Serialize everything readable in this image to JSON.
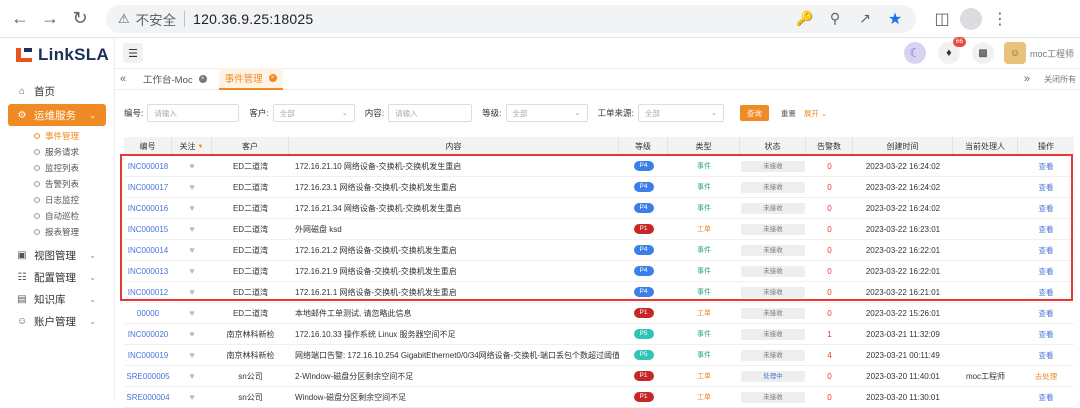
{
  "browser": {
    "security": "不安全",
    "url": "120.36.9.25:18025"
  },
  "app": {
    "logo": "LinkSLA",
    "user_name": "moc工程师",
    "notification_count": "66"
  },
  "sidebar": {
    "items": [
      {
        "label": "首页",
        "icon": "home-icon"
      },
      {
        "label": "运维服务",
        "icon": "service-icon",
        "active": true
      },
      {
        "label": "视图管理",
        "icon": "view-icon"
      },
      {
        "label": "配置管理",
        "icon": "config-icon"
      },
      {
        "label": "知识库",
        "icon": "kb-icon"
      },
      {
        "label": "账户管理",
        "icon": "account-icon"
      }
    ],
    "sub_items": [
      "事件管理",
      "服务请求",
      "监控列表",
      "告警列表",
      "日志监控",
      "自动巡检",
      "报表管理"
    ]
  },
  "tabs": {
    "items": [
      {
        "label": "工作台-Moc"
      },
      {
        "label": "事件管理"
      }
    ],
    "close_all": "关闭所有"
  },
  "filters": {
    "id_label": "编号:",
    "id_placeholder": "请输入",
    "customer_label": "客户:",
    "customer_value": "全部",
    "content_label": "内容:",
    "content_placeholder": "请输入",
    "level_label": "等级:",
    "level_value": "全部",
    "source_label": "工单来源:",
    "source_value": "全部",
    "query": "查询",
    "reset": "重置",
    "expand": "展开"
  },
  "table": {
    "headers": [
      "编号",
      "关注",
      "客户",
      "内容",
      "等级",
      "类型",
      "状态",
      "告警数",
      "创建时间",
      "当前处理人",
      "操作"
    ],
    "rows": [
      {
        "id": "INC000018",
        "customer": "ED二道湾",
        "content": "172.16.21.10 网络设备-交换机-交换机发生重启",
        "level": "P4",
        "type": "事件",
        "status": "未接收",
        "count": "0",
        "time": "2023-03-22 16:24:02",
        "handler": "",
        "action": "查看"
      },
      {
        "id": "INC000017",
        "customer": "ED二道湾",
        "content": "172.16.23.1 网络设备-交换机-交换机发生重启",
        "level": "P4",
        "type": "事件",
        "status": "未接收",
        "count": "0",
        "time": "2023-03-22 16:24:02",
        "handler": "",
        "action": "查看"
      },
      {
        "id": "INC000016",
        "customer": "ED二道湾",
        "content": "172.16.21.34 网络设备-交换机-交换机发生重启",
        "level": "P4",
        "type": "事件",
        "status": "未接收",
        "count": "0",
        "time": "2023-03-22 16:24:02",
        "handler": "",
        "action": "查看"
      },
      {
        "id": "INC000015",
        "customer": "ED二道湾",
        "content": "外网磁盘 ksd",
        "level": "P1",
        "type": "工单",
        "status": "未接收",
        "count": "0",
        "time": "2023-03-22 16:23:01",
        "handler": "",
        "action": "查看"
      },
      {
        "id": "INC000014",
        "customer": "ED二道湾",
        "content": "172.16.21.2 网络设备-交换机-交换机发生重启",
        "level": "P4",
        "type": "事件",
        "status": "未接收",
        "count": "0",
        "time": "2023-03-22 16:22:01",
        "handler": "",
        "action": "查看"
      },
      {
        "id": "INC000013",
        "customer": "ED二道湾",
        "content": "172.16.21.9 网络设备-交换机-交换机发生重启",
        "level": "P4",
        "type": "事件",
        "status": "未接收",
        "count": "0",
        "time": "2023-03-22 16:22:01",
        "handler": "",
        "action": "查看"
      },
      {
        "id": "INC000012",
        "customer": "ED二道湾",
        "content": "172.16.21.1 网络设备-交换机-交换机发生重启",
        "level": "P4",
        "type": "事件",
        "status": "未接收",
        "count": "0",
        "time": "2023-03-22 16:21:01",
        "handler": "",
        "action": "查看"
      },
      {
        "id": "00000",
        "customer": "ED二道湾",
        "content": "本地邮件工单测试, 请忽略此信息",
        "level": "P1",
        "type": "工单",
        "status": "未接收",
        "count": "0",
        "time": "2023-03-22 15:26:01",
        "handler": "",
        "action": "查看"
      },
      {
        "id": "INC000020",
        "customer": "南京林科新检",
        "content": "172.16.10.33 操作系统 Linux 服务器空间不足",
        "level": "P5",
        "type": "事件",
        "status": "未接收",
        "count": "1",
        "time": "2023-03-21 11:32:09",
        "handler": "",
        "action": "查看"
      },
      {
        "id": "INC000019",
        "customer": "南京林科新检",
        "content": "网络端口告警: 172.16.10.254 GigabitEthernet0/0/34网络设备-交换机-端口丢包个数超过阈值",
        "level": "P5",
        "type": "事件",
        "status": "未接收",
        "count": "4",
        "time": "2023-03-21 00:11:49",
        "handler": "",
        "action": "查看"
      },
      {
        "id": "SRE000005",
        "customer": "sn公司",
        "content": "2-Window-磁盘分区剩余空间不足",
        "level": "P1",
        "type": "工单",
        "status": "处理中",
        "count": "0",
        "time": "2023-03-20 11:40:01",
        "handler": "moc工程师",
        "action": "去处理"
      },
      {
        "id": "SRE000004",
        "customer": "sn公司",
        "content": "Window-磁盘分区剩余空间不足",
        "level": "P1",
        "type": "工单",
        "status": "未接收",
        "count": "0",
        "time": "2023-03-20 11:30:01",
        "handler": "",
        "action": "查看"
      }
    ]
  }
}
